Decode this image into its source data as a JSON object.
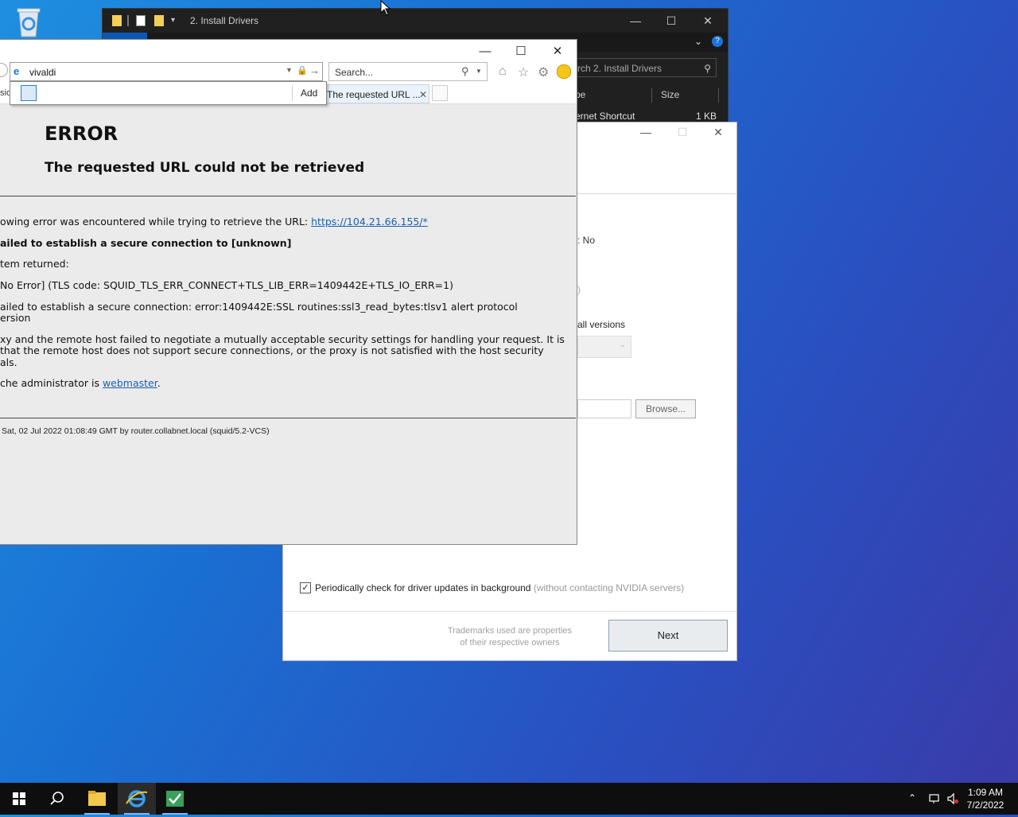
{
  "desktop": {
    "recycle_bin_icon": "recycle-bin-icon"
  },
  "explorer": {
    "title": "2. Install Drivers",
    "search_placeholder": "rch 2. Install Drivers",
    "col_type": "pe",
    "col_size": "Size",
    "file_type": "ernet Shortcut",
    "file_size": "1 KB"
  },
  "nvidia": {
    "partial_no": ": No",
    "partial_paren": ")",
    "partial_versions": "all versions",
    "browse_label": "Browse...",
    "checkbox_label": "Periodically check for driver updates in background",
    "checkbox_note": "(without contacting NVIDIA servers)",
    "trademark_line1": "Trademarks used are properties",
    "trademark_line2": "of their respective owners",
    "next_label": "Next"
  },
  "ie": {
    "address_value": "vivaldi",
    "search_placeholder": "Search...",
    "dropdown_add": "Add",
    "tab_title": "The requested URL ...",
    "left_cut_text": "sio",
    "error": {
      "title": "ERROR",
      "subtitle": "The requested URL could not be retrieved",
      "line1_prefix": "owing error was encountered while trying to retrieve the URL: ",
      "line1_link": "https://104.21.66.155/*",
      "line2": "ailed to establish a secure connection to [unknown]",
      "line3": "tem returned:",
      "line4": "No Error] (TLS code: SQUID_TLS_ERR_CONNECT+TLS_LIB_ERR=1409442E+TLS_IO_ERR=1)",
      "line5a": "ailed to establish a secure connection: error:1409442E:SSL routines:ssl3_read_bytes:tlsv1 alert protocol",
      "line5b": "ersion",
      "line6a": "xy and the remote host failed to negotiate a mutually acceptable security settings for handling your request. It is",
      "line6b": " that the remote host does not support secure connections, or the proxy is not satisfied with the host security",
      "line6c": "als.",
      "line7_prefix": "che administrator is ",
      "line7_link": "webmaster",
      "line7_suffix": ".",
      "footer": "Sat, 02 Jul 2022 01:08:49 GMT by router.collabnet.local (squid/5.2-VCS)"
    }
  },
  "taskbar": {
    "time": "1:09 AM",
    "date": "7/2/2022"
  }
}
